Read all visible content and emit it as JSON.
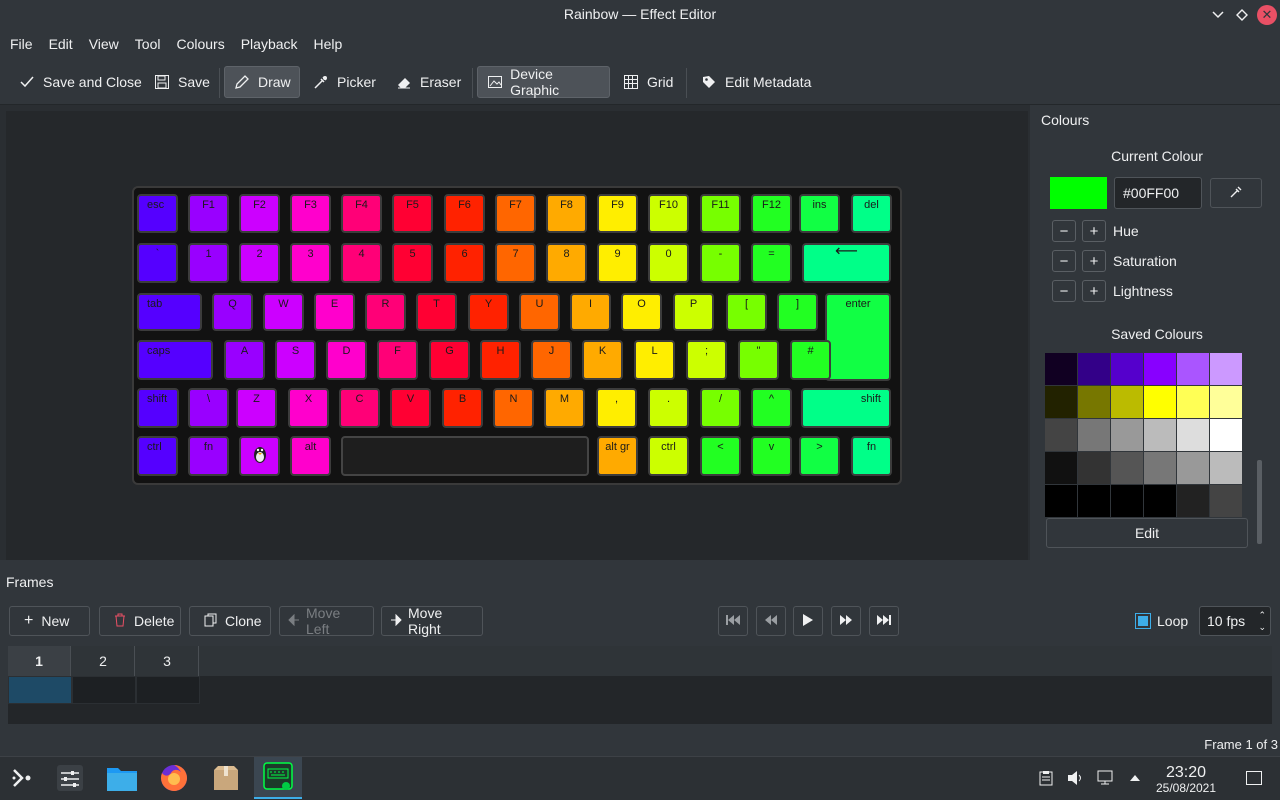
{
  "window": {
    "title": "Rainbow — Effect Editor"
  },
  "menu": [
    "File",
    "Edit",
    "View",
    "Tool",
    "Colours",
    "Playback",
    "Help"
  ],
  "toolbar": {
    "save_close": "Save and Close",
    "save": "Save",
    "draw": "Draw",
    "picker": "Picker",
    "eraser": "Eraser",
    "device_graphic": "Device Graphic",
    "grid": "Grid",
    "edit_metadata": "Edit Metadata"
  },
  "keyboard": {
    "row1": [
      "esc",
      "F1",
      "F2",
      "F3",
      "F4",
      "F5",
      "F6",
      "F7",
      "F8",
      "F9",
      "F10",
      "F11",
      "F12",
      "ins",
      "del"
    ],
    "row2": [
      "`",
      "1",
      "2",
      "3",
      "4",
      "5",
      "6",
      "7",
      "8",
      "9",
      "0",
      "-",
      "=",
      "⟵"
    ],
    "row3": [
      "tab",
      "Q",
      "W",
      "E",
      "R",
      "T",
      "Y",
      "U",
      "I",
      "O",
      "P",
      "[",
      "]",
      "enter"
    ],
    "row4": [
      "caps",
      "A",
      "S",
      "D",
      "F",
      "G",
      "H",
      "J",
      "K",
      "L",
      ";",
      "\"",
      "#"
    ],
    "row5": [
      "shift",
      "\\",
      "Z",
      "X",
      "C",
      "V",
      "B",
      "N",
      "M",
      ",",
      ".",
      "/",
      "^",
      "shift"
    ],
    "row6": [
      "ctrl",
      "fn",
      "",
      "alt",
      "",
      "alt gr",
      "ctrl",
      "<",
      "v",
      ">",
      "fn"
    ],
    "colors": {
      "row1": [
        "#5500ff",
        "#9900ff",
        "#cc00ff",
        "#ff00cc",
        "#ff0077",
        "#ff0033",
        "#ff2200",
        "#ff6600",
        "#ffaa00",
        "#ffee00",
        "#ccff00",
        "#77ff00",
        "#22ff22",
        "#11ff44",
        "#00ff88"
      ],
      "row2": [
        "#5500ff",
        "#9900ff",
        "#cc00ff",
        "#ff00cc",
        "#ff0077",
        "#ff0033",
        "#ff2200",
        "#ff6600",
        "#ffaa00",
        "#ffee00",
        "#ccff00",
        "#77ff00",
        "#22ff22",
        "#00ff88"
      ],
      "row3": [
        "#5500ff",
        "#9900ff",
        "#cc00ff",
        "#ff00cc",
        "#ff0077",
        "#ff0033",
        "#ff2200",
        "#ff6600",
        "#ffaa00",
        "#ffee00",
        "#ccff00",
        "#77ff00",
        "#22ff22",
        "#11ff44"
      ],
      "row4": [
        "#5500ff",
        "#9900ff",
        "#cc00ff",
        "#ff00cc",
        "#ff0077",
        "#ff0033",
        "#ff2200",
        "#ff6600",
        "#ffaa00",
        "#ffee00",
        "#ccff00",
        "#77ff00",
        "#22ff22"
      ],
      "row5": [
        "#5500ff",
        "#9900ff",
        "#cc00ff",
        "#ff00cc",
        "#ff0077",
        "#ff0033",
        "#ff2200",
        "#ff6600",
        "#ffaa00",
        "#ffee00",
        "#ccff00",
        "#77ff00",
        "#22ff22",
        "#00ff88"
      ],
      "row6": [
        "#5500ff",
        "#9900ff",
        "#cc00ff",
        "#ff00cc",
        "#1e1e1e",
        "#ffaa00",
        "#ccff00",
        "#22ff22",
        "#22ff22",
        "#11ff44",
        "#00ff88"
      ]
    }
  },
  "colours_panel": {
    "title": "Colours",
    "current_label": "Current Colour",
    "current_hex": "#00FF00",
    "current_color": "#00ff00",
    "hue": "Hue",
    "saturation": "Saturation",
    "lightness": "Lightness",
    "saved_label": "Saved Colours",
    "saved": [
      [
        "#110022",
        "#330088",
        "#5500cc",
        "#8800ff",
        "#aa55ff",
        "#cc99ff"
      ],
      [
        "#222200",
        "#777700",
        "#bbbb00",
        "#ffff00",
        "#ffff55",
        "#ffff99"
      ],
      [
        "#444444",
        "#777777",
        "#999999",
        "#bbbbbb",
        "#dddddd",
        "#ffffff"
      ],
      [
        "#111111",
        "#333333",
        "#555555",
        "#777777",
        "#999999",
        "#bbbbbb"
      ],
      [
        "#000000",
        "#000000",
        "#000000",
        "#000000",
        "#222222",
        "#444444"
      ]
    ],
    "edit": "Edit"
  },
  "frames": {
    "title": "Frames",
    "new": "New",
    "delete": "Delete",
    "clone": "Clone",
    "move_left": "Move Left",
    "move_right": "Move Right",
    "loop": "Loop",
    "fps": "10 fps",
    "tabs": [
      "1",
      "2",
      "3"
    ],
    "status": "Frame 1 of 3"
  },
  "taskbar": {
    "time": "23:20",
    "date": "25/08/2021"
  }
}
